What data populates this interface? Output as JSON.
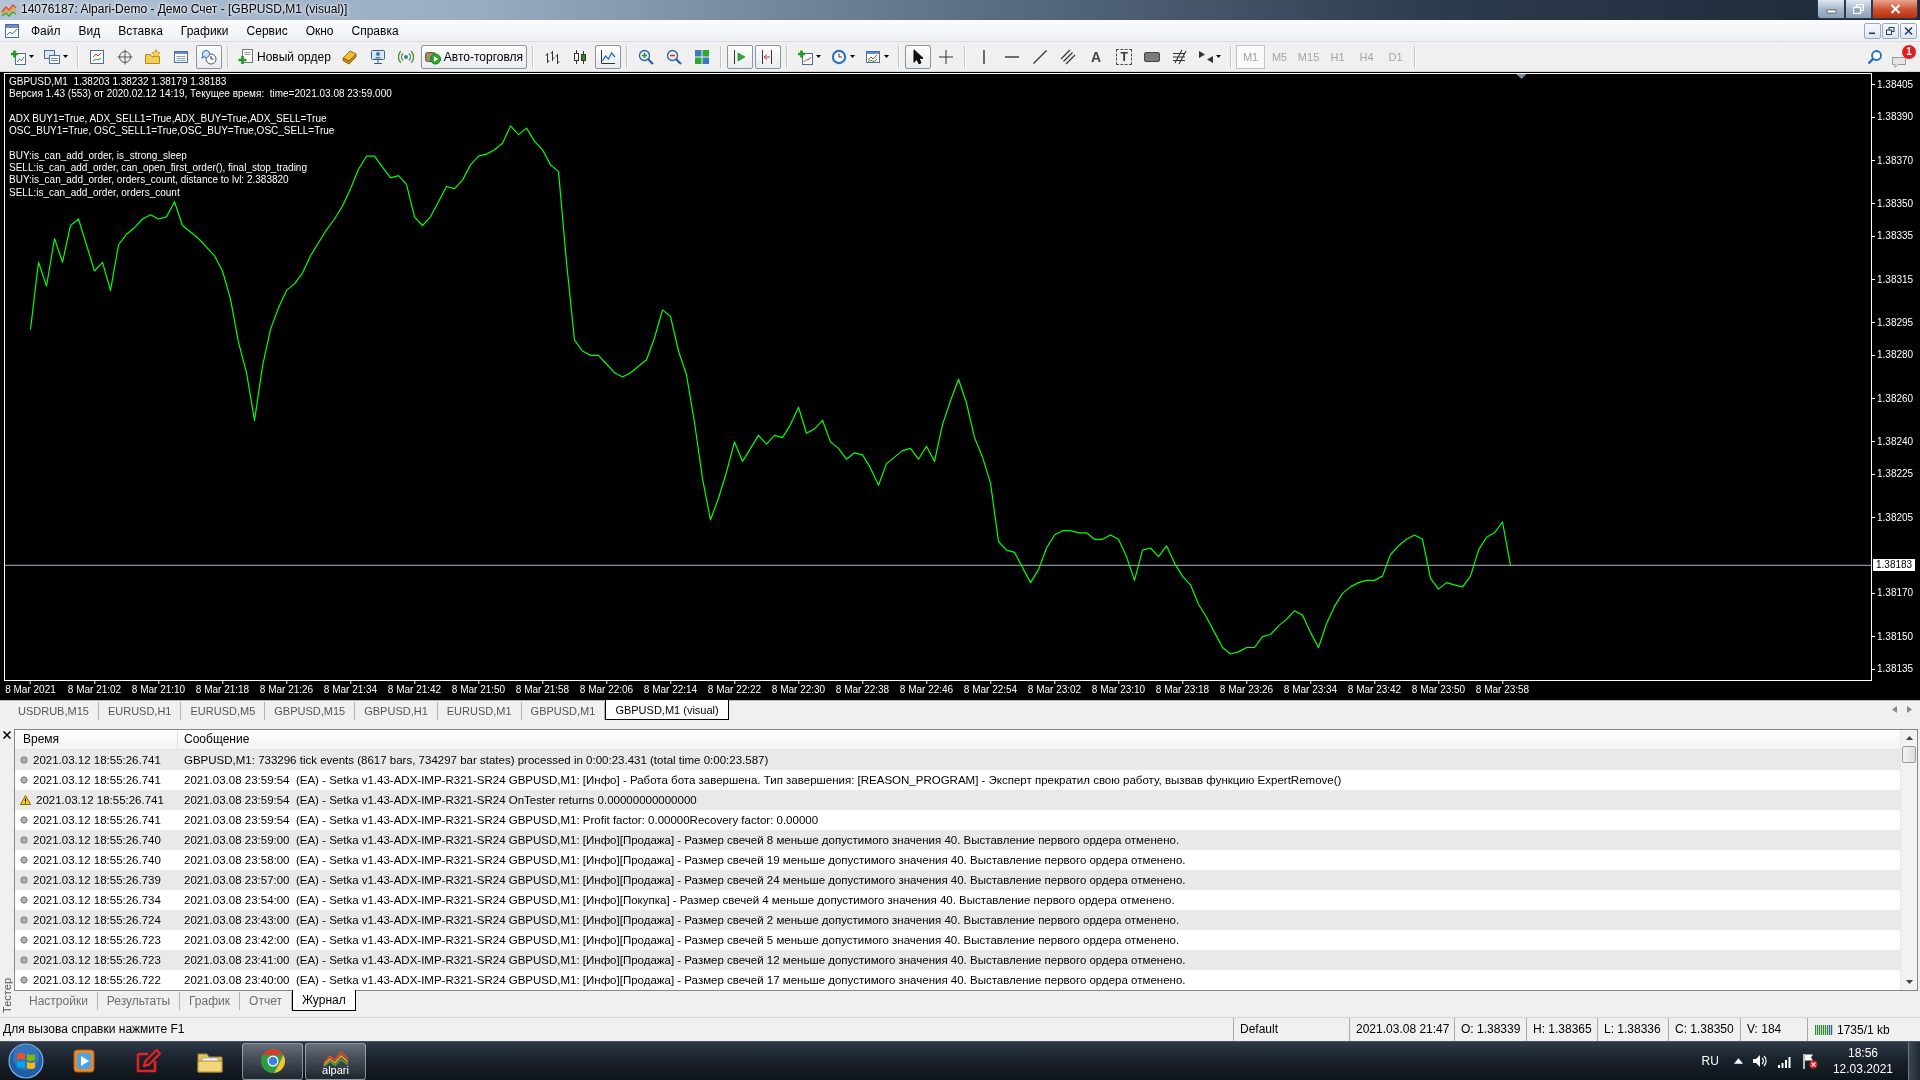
{
  "window": {
    "title": "14076187: Alpari-Demo - Демо Счет - [GBPUSD,M1 (visual)]"
  },
  "menu": [
    "Файл",
    "Вид",
    "Вставка",
    "Графики",
    "Сервис",
    "Окно",
    "Справка"
  ],
  "toolbar": {
    "tools": [
      {
        "kind": "newchart",
        "pressed": false
      },
      {
        "kind": "profiles",
        "pressed": false
      },
      {
        "kind": "separator"
      },
      {
        "kind": "marketwatch",
        "pressed": false
      },
      {
        "kind": "navigator",
        "pressed": false
      },
      {
        "kind": "favorites",
        "pressed": false
      },
      {
        "kind": "terminal",
        "pressed": false
      },
      {
        "kind": "tester",
        "pressed": true
      },
      {
        "kind": "separator"
      },
      {
        "kind": "order",
        "label": "Новый ордер",
        "pressed": false
      },
      {
        "kind": "editor",
        "pressed": false
      },
      {
        "kind": "signals",
        "pressed": false
      },
      {
        "kind": "market",
        "pressed": false
      },
      {
        "kind": "autotrading",
        "label": "Авто-торговля",
        "pressed": true
      },
      {
        "kind": "separator"
      },
      {
        "kind": "bars",
        "pressed": false
      },
      {
        "kind": "candles",
        "pressed": false
      },
      {
        "kind": "line",
        "pressed": true
      },
      {
        "kind": "separator"
      },
      {
        "kind": "zoomin",
        "pressed": false
      },
      {
        "kind": "zoomout",
        "pressed": false
      },
      {
        "kind": "tile",
        "pressed": false
      },
      {
        "kind": "separator"
      },
      {
        "kind": "autoscroll",
        "pressed": true
      },
      {
        "kind": "chartshift",
        "pressed": true
      },
      {
        "kind": "separator"
      },
      {
        "kind": "indicators",
        "pressed": false
      },
      {
        "kind": "periods",
        "pressed": false
      },
      {
        "kind": "templates",
        "pressed": false
      },
      {
        "kind": "separator"
      },
      {
        "kind": "cursor",
        "pressed": true
      },
      {
        "kind": "crosshair",
        "pressed": false
      },
      {
        "kind": "separator"
      },
      {
        "kind": "vline",
        "pressed": false
      },
      {
        "kind": "hline",
        "pressed": false
      },
      {
        "kind": "trend",
        "pressed": false
      },
      {
        "kind": "channel",
        "pressed": false
      },
      {
        "kind": "text",
        "glyph": "A",
        "pressed": false
      },
      {
        "kind": "label",
        "glyph": "T",
        "pressed": false
      },
      {
        "kind": "rectangle",
        "pressed": false
      },
      {
        "kind": "fibo",
        "pressed": false
      },
      {
        "kind": "arrows",
        "pressed": false
      },
      {
        "kind": "separator"
      }
    ],
    "timeframes": [
      {
        "label": "M1",
        "selected": true,
        "disabled": true
      },
      {
        "label": "M5",
        "selected": false,
        "disabled": true
      },
      {
        "label": "M15",
        "selected": false,
        "disabled": true
      },
      {
        "label": "H1",
        "selected": false,
        "disabled": true
      },
      {
        "label": "H4",
        "selected": false,
        "disabled": true
      },
      {
        "label": "D1",
        "selected": false,
        "disabled": true
      }
    ],
    "notifications": "1"
  },
  "chart": {
    "comment_blocks": [
      [
        "GBPUSD,M1  1.38203 1.38232 1.38179 1.38183",
        "Версия 1.43 (553) от 2020.02.12 14:19, Текущее время:  time=2021.03.08 23:59.000"
      ],
      [
        "ADX BUY1=True, ADX_SELL1=True,ADX_BUY=True,ADX_SELL=True",
        "OSC_BUY1=True, OSC_SELL1=True,OSC_BUY=True,OSC_SELL=True"
      ],
      [
        "BUY:is_can_add_order, is_strong_sleep",
        "SELL:is_can_add_order, can_open_first_order(), final_stop_trading",
        "BUY:is_can_add_order, orders_count, distance to lvl: 2.383820",
        "SELL:is_can_add_order, orders_count"
      ]
    ],
    "chart_data": {
      "type": "line",
      "color": "#00ff00",
      "ylim": [
        1.3813,
        1.3841
      ],
      "yticks": [
        {
          "value": 1.38405,
          "label": "1.38405"
        },
        {
          "value": 1.3839,
          "label": "1.38390"
        },
        {
          "value": 1.3837,
          "label": "1.38370"
        },
        {
          "value": 1.3835,
          "label": "1.38350"
        },
        {
          "value": 1.38335,
          "label": "1.38335"
        },
        {
          "value": 1.38315,
          "label": "1.38315"
        },
        {
          "value": 1.38295,
          "label": "1.38295"
        },
        {
          "value": 1.3828,
          "label": "1.38280"
        },
        {
          "value": 1.3826,
          "label": "1.38260"
        },
        {
          "value": 1.3824,
          "label": "1.38240"
        },
        {
          "value": 1.38225,
          "label": "1.38225"
        },
        {
          "value": 1.38205,
          "label": "1.38205"
        },
        {
          "value": 1.3817,
          "label": "1.38170"
        },
        {
          "value": 1.3815,
          "label": "1.38150"
        },
        {
          "value": 1.38135,
          "label": "1.38135"
        }
      ],
      "ref_lines": [
        {
          "axis": "y",
          "value": 1.38183,
          "label": "1.38183",
          "color": "#a9b4c0"
        }
      ],
      "categories": [
        "8 Mar 2021",
        null,
        null,
        null,
        null,
        null,
        null,
        null,
        "8 Mar 21:02",
        null,
        null,
        null,
        null,
        null,
        null,
        null,
        "8 Mar 21:10",
        null,
        null,
        null,
        null,
        null,
        null,
        null,
        "8 Mar 21:18",
        null,
        null,
        null,
        null,
        null,
        null,
        null,
        "8 Mar 21:26",
        null,
        null,
        null,
        null,
        null,
        null,
        null,
        "8 Mar 21:34",
        null,
        null,
        null,
        null,
        null,
        null,
        null,
        "8 Mar 21:42",
        null,
        null,
        null,
        null,
        null,
        null,
        null,
        "8 Mar 21:50",
        null,
        null,
        null,
        null,
        null,
        null,
        null,
        "8 Mar 21:58",
        null,
        null,
        null,
        null,
        null,
        null,
        null,
        "8 Mar 22:06",
        null,
        null,
        null,
        null,
        null,
        null,
        null,
        "8 Mar 22:14",
        null,
        null,
        null,
        null,
        null,
        null,
        null,
        "8 Mar 22:22",
        null,
        null,
        null,
        null,
        null,
        null,
        null,
        "8 Mar 22:30",
        null,
        null,
        null,
        null,
        null,
        null,
        null,
        "8 Mar 22:38",
        null,
        null,
        null,
        null,
        null,
        null,
        null,
        "8 Mar 22:46",
        null,
        null,
        null,
        null,
        null,
        null,
        null,
        "8 Mar 22:54",
        null,
        null,
        null,
        null,
        null,
        null,
        null,
        "8 Mar 23:02",
        null,
        null,
        null,
        null,
        null,
        null,
        null,
        "8 Mar 23:10",
        null,
        null,
        null,
        null,
        null,
        null,
        null,
        "8 Mar 23:18",
        null,
        null,
        null,
        null,
        null,
        null,
        null,
        "8 Mar 23:26",
        null,
        null,
        null,
        null,
        null,
        null,
        null,
        "8 Mar 23:34",
        null,
        null,
        null,
        null,
        null,
        null,
        null,
        "8 Mar 23:42",
        null,
        null,
        null,
        null,
        null,
        null,
        null,
        "8 Mar 23:50",
        null,
        null,
        null,
        null,
        null,
        null,
        null,
        "8 Mar 23:58",
        null
      ],
      "values": [
        1.38292,
        1.38323,
        1.38312,
        1.38334,
        1.38323,
        1.3834,
        1.38343,
        1.38331,
        1.38319,
        1.38323,
        1.3831,
        1.38331,
        1.38336,
        1.38339,
        1.38343,
        1.38345,
        1.38343,
        1.38344,
        1.38351,
        1.3834,
        1.38337,
        1.38334,
        1.3833,
        1.38326,
        1.38319,
        1.38306,
        1.38286,
        1.38272,
        1.3825,
        1.38275,
        1.38292,
        1.38302,
        1.3831,
        1.38313,
        1.38318,
        1.38326,
        1.38332,
        1.38338,
        1.38343,
        1.38349,
        1.38357,
        1.38366,
        1.38372,
        1.38372,
        1.38367,
        1.38362,
        1.38363,
        1.38359,
        1.38344,
        1.3834,
        1.38344,
        1.38351,
        1.38358,
        1.38357,
        1.38361,
        1.38368,
        1.38372,
        1.38373,
        1.38375,
        1.38378,
        1.38386,
        1.38382,
        1.38385,
        1.38379,
        1.38375,
        1.38368,
        1.38365,
        1.38323,
        1.38287,
        1.38282,
        1.3828,
        1.3828,
        1.38276,
        1.38272,
        1.3827,
        1.38272,
        1.38275,
        1.38278,
        1.38288,
        1.38301,
        1.38298,
        1.38282,
        1.38271,
        1.38249,
        1.38223,
        1.38204,
        1.38214,
        1.38226,
        1.3824,
        1.38231,
        1.38237,
        1.38243,
        1.38239,
        1.38243,
        1.38242,
        1.38248,
        1.38256,
        1.38244,
        1.38246,
        1.3825,
        1.3824,
        1.38237,
        1.38232,
        1.38235,
        1.38234,
        1.38228,
        1.3822,
        1.3823,
        1.38233,
        1.38236,
        1.38237,
        1.38232,
        1.38238,
        1.38231,
        1.38248,
        1.38259,
        1.38269,
        1.38258,
        1.38242,
        1.38233,
        1.38221,
        1.38194,
        1.3819,
        1.38189,
        1.38182,
        1.38175,
        1.38181,
        1.38191,
        1.38197,
        1.38199,
        1.38199,
        1.38198,
        1.38198,
        1.38195,
        1.38195,
        1.38197,
        1.38195,
        1.38187,
        1.38176,
        1.3819,
        1.38191,
        1.38187,
        1.38192,
        1.38184,
        1.38178,
        1.38174,
        1.38165,
        1.38159,
        1.38152,
        1.38145,
        1.38142,
        1.38143,
        1.38145,
        1.38145,
        1.3815,
        1.38151,
        1.38155,
        1.38158,
        1.38162,
        1.3816,
        1.38152,
        1.38145,
        1.38156,
        1.38164,
        1.3817,
        1.38173,
        1.38175,
        1.38176,
        1.38176,
        1.38178,
        1.38188,
        1.38192,
        1.38195,
        1.38197,
        1.38195,
        1.38177,
        1.38172,
        1.38175,
        1.38174,
        1.38173,
        1.38178,
        1.3819,
        1.38196,
        1.38198,
        1.38203,
        1.38183
      ]
    }
  },
  "chart_tabs": [
    {
      "label": "USDRUB,M15",
      "selected": false
    },
    {
      "label": "EURUSD,H1",
      "selected": false
    },
    {
      "label": "EURUSD,M5",
      "selected": false
    },
    {
      "label": "GBPUSD,M15",
      "selected": false
    },
    {
      "label": "GBPUSD,H1",
      "selected": false
    },
    {
      "label": "EURUSD,M1",
      "selected": false
    },
    {
      "label": "GBPUSD,M1",
      "selected": false
    },
    {
      "label": "GBPUSD,M1 (visual)",
      "selected": true
    }
  ],
  "tester": {
    "title": "Тестер",
    "columns": [
      "Время",
      "Сообщение"
    ],
    "rows": [
      {
        "kind": "info",
        "time": "2021.03.12 18:55:26.741",
        "message": "GBPUSD,M1: 733296 tick events (8617 bars, 734297 bar states) processed in 0:00:23.431 (total time 0:00:23.587)"
      },
      {
        "kind": "info",
        "time": "2021.03.12 18:55:26.741",
        "message": "2021.03.08 23:59:54  (EA) - Setka v1.43-ADX-IMP-R321-SR24 GBPUSD,M1: [Инфо] - Работа бота завершена. Тип завершения: [REASON_PROGRAM] - Эксперт прекратил свою работу, вызвав функцию ExpertRemove()"
      },
      {
        "kind": "warning",
        "time": "2021.03.12 18:55:26.741",
        "message": "2021.03.08 23:59:54  (EA) - Setka v1.43-ADX-IMP-R321-SR24 OnTester returns 0.00000000000000"
      },
      {
        "kind": "info",
        "time": "2021.03.12 18:55:26.741",
        "message": "2021.03.08 23:59:54  (EA) - Setka v1.43-ADX-IMP-R321-SR24 GBPUSD,M1: Profit factor: 0.00000Recovery factor: 0.00000"
      },
      {
        "kind": "info",
        "time": "2021.03.12 18:55:26.740",
        "message": "2021.03.08 23:59:00  (EA) - Setka v1.43-ADX-IMP-R321-SR24 GBPUSD,M1: [Инфо][Продажа] - Размер свечей 8 меньше допустимого значения 40. Выставление первого ордера отменено."
      },
      {
        "kind": "info",
        "time": "2021.03.12 18:55:26.740",
        "message": "2021.03.08 23:58:00  (EA) - Setka v1.43-ADX-IMP-R321-SR24 GBPUSD,M1: [Инфо][Продажа] - Размер свечей 19 меньше допустимого значения 40. Выставление первого ордера отменено."
      },
      {
        "kind": "info",
        "time": "2021.03.12 18:55:26.739",
        "message": "2021.03.08 23:57:00  (EA) - Setka v1.43-ADX-IMP-R321-SR24 GBPUSD,M1: [Инфо][Продажа] - Размер свечей 24 меньше допустимого значения 40. Выставление первого ордера отменено."
      },
      {
        "kind": "info",
        "time": "2021.03.12 18:55:26.734",
        "message": "2021.03.08 23:54:00  (EA) - Setka v1.43-ADX-IMP-R321-SR24 GBPUSD,M1: [Инфо][Покупка] - Размер свечей 4 меньше допустимого значения 40. Выставление первого ордера отменено."
      },
      {
        "kind": "info",
        "time": "2021.03.12 18:55:26.724",
        "message": "2021.03.08 23:43:00  (EA) - Setka v1.43-ADX-IMP-R321-SR24 GBPUSD,M1: [Инфо][Продажа] - Размер свечей 2 меньше допустимого значения 40. Выставление первого ордера отменено."
      },
      {
        "kind": "info",
        "time": "2021.03.12 18:55:26.723",
        "message": "2021.03.08 23:42:00  (EA) - Setka v1.43-ADX-IMP-R321-SR24 GBPUSD,M1: [Инфо][Продажа] - Размер свечей 5 меньше допустимого значения 40. Выставление первого ордера отменено."
      },
      {
        "kind": "info",
        "time": "2021.03.12 18:55:26.723",
        "message": "2021.03.08 23:41:00  (EA) - Setka v1.43-ADX-IMP-R321-SR24 GBPUSD,M1: [Инфо][Продажа] - Размер свечей 12 меньше допустимого значения 40. Выставление первого ордера отменено."
      },
      {
        "kind": "info",
        "time": "2021.03.12 18:55:26.722",
        "message": "2021.03.08 23:40:00  (EA) - Setka v1.43-ADX-IMP-R321-SR24 GBPUSD,M1: [Инфо][Продажа] - Размер свечей 17 меньше допустимого значения 40. Выставление первого ордера отменено."
      }
    ],
    "tabs": [
      {
        "label": "Настройки",
        "selected": false
      },
      {
        "label": "Результаты",
        "selected": false
      },
      {
        "label": "График",
        "selected": false
      },
      {
        "label": "Отчет",
        "selected": false
      },
      {
        "label": "Журнал",
        "selected": true
      }
    ]
  },
  "status_bar": {
    "help": "Для вызова справки нажмите F1",
    "fields": [
      "Default",
      "2021.03.08 21:47",
      "O: 1.38339",
      "H: 1.38365",
      "L: 1.38336",
      "C: 1.38350",
      "V: 184"
    ],
    "traffic": "1735/1 kb"
  },
  "taskbar": {
    "apps": [
      {
        "kind": "player",
        "running": false
      },
      {
        "kind": "pen",
        "running": false
      },
      {
        "kind": "folder",
        "running": false
      },
      {
        "kind": "browser",
        "running": true
      },
      {
        "kind": "terminal",
        "label": "alpari",
        "running": true
      }
    ],
    "language": "RU",
    "time": "18:56",
    "date": "12.03.2021"
  }
}
